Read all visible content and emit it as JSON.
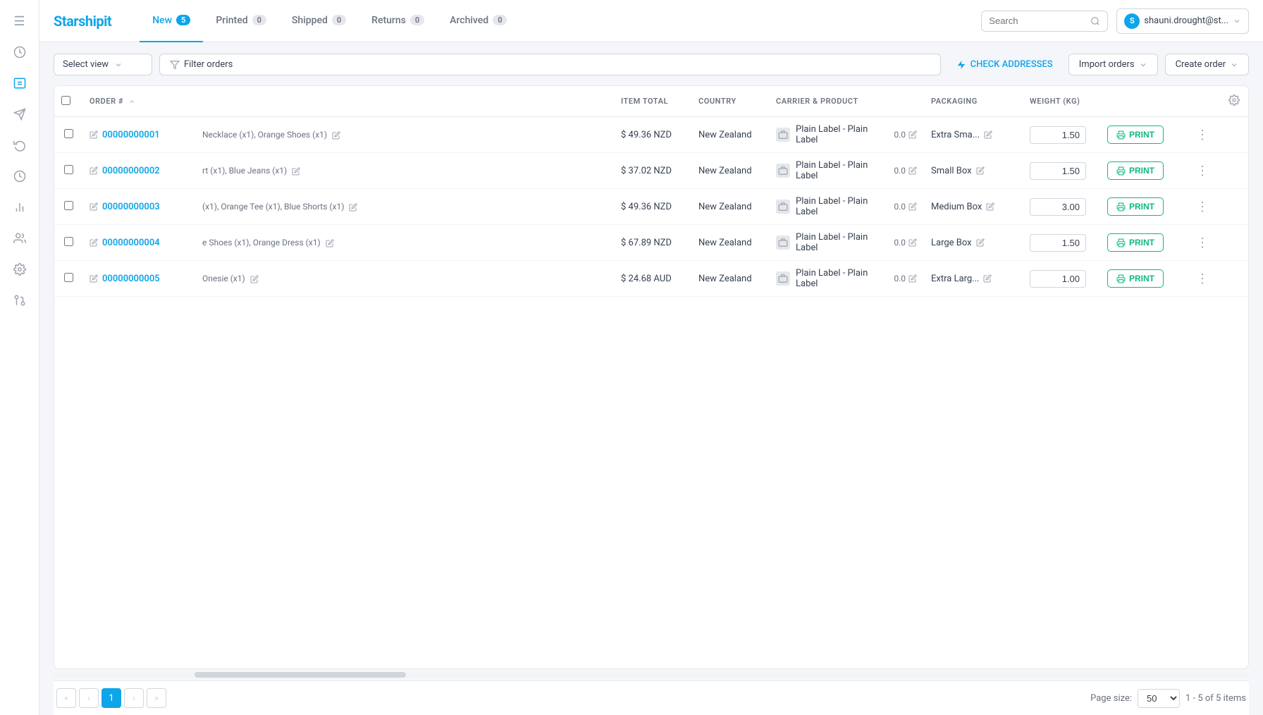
{
  "app": {
    "name": "Starshipit"
  },
  "sidebar": {
    "icons": [
      {
        "name": "menu-icon",
        "symbol": "☰"
      },
      {
        "name": "dashboard-icon",
        "symbol": "○"
      },
      {
        "name": "box-icon",
        "symbol": "⬡"
      },
      {
        "name": "send-icon",
        "symbol": "➤"
      },
      {
        "name": "history-icon",
        "symbol": "↺"
      },
      {
        "name": "clock-icon",
        "symbol": "🕐"
      },
      {
        "name": "chart-icon",
        "symbol": "▦"
      },
      {
        "name": "users-icon",
        "symbol": "👤"
      },
      {
        "name": "settings-icon",
        "symbol": "⚙"
      },
      {
        "name": "integration-icon",
        "symbol": "⚡"
      }
    ]
  },
  "nav": {
    "tabs": [
      {
        "label": "New",
        "count": "5",
        "active": true,
        "zero": false
      },
      {
        "label": "Printed",
        "count": "0",
        "active": false,
        "zero": true
      },
      {
        "label": "Shipped",
        "count": "0",
        "active": false,
        "zero": true
      },
      {
        "label": "Returns",
        "count": "0",
        "active": false,
        "zero": true
      },
      {
        "label": "Archived",
        "count": "0",
        "active": false,
        "zero": true
      }
    ]
  },
  "header": {
    "search_placeholder": "Search",
    "user_label": "shauni.drought@st...",
    "user_initials": "S"
  },
  "toolbar": {
    "select_view_label": "Select view",
    "filter_label": "Filter orders",
    "check_addresses_label": "CHECK ADDRESSES",
    "import_orders_label": "Import orders",
    "create_order_label": "Create order"
  },
  "table": {
    "columns": [
      {
        "label": "",
        "key": "check"
      },
      {
        "label": "ORDER #",
        "key": "order"
      },
      {
        "label": "ITEM TOTAL",
        "key": "total"
      },
      {
        "label": "COUNTRY",
        "key": "country"
      },
      {
        "label": "CARRIER & PRODUCT",
        "key": "carrier"
      },
      {
        "label": "PACKAGING",
        "key": "packaging"
      },
      {
        "label": "WEIGHT (KG)",
        "key": "weight"
      },
      {
        "label": "",
        "key": "print"
      },
      {
        "label": "",
        "key": "more"
      },
      {
        "label": "⚙",
        "key": "settings"
      }
    ],
    "rows": [
      {
        "id": "00000000001",
        "items": "Necklace (x1), Orange Shoes (x1)",
        "total": "$ 49.36 NZD",
        "country": "New Zealand",
        "carrier": "Plain Label - Plain Label",
        "carrier_score": "0.0",
        "packaging": "Extra Sma...",
        "weight": "1.50"
      },
      {
        "id": "00000000002",
        "items": "rt (x1), Blue Jeans (x1)",
        "total": "$ 37.02 NZD",
        "country": "New Zealand",
        "carrier": "Plain Label - Plain Label",
        "carrier_score": "0.0",
        "packaging": "Small Box",
        "weight": "1.50"
      },
      {
        "id": "00000000003",
        "items": "(x1), Orange Tee (x1), Blue Shorts (x1)",
        "total": "$ 49.36 NZD",
        "country": "New Zealand",
        "carrier": "Plain Label - Plain Label",
        "carrier_score": "0.0",
        "packaging": "Medium Box",
        "weight": "3.00"
      },
      {
        "id": "00000000004",
        "items": "e Shoes (x1), Orange Dress (x1)",
        "total": "$ 67.89 NZD",
        "country": "New Zealand",
        "carrier": "Plain Label - Plain Label",
        "carrier_score": "0.0",
        "packaging": "Large Box",
        "weight": "1.50"
      },
      {
        "id": "00000000005",
        "items": "Onesie (x1)",
        "total": "$ 24.68 AUD",
        "country": "New Zealand",
        "carrier": "Plain Label - Plain Label",
        "carrier_score": "0.0",
        "packaging": "Extra Larg...",
        "weight": "1.00"
      }
    ]
  },
  "pagination": {
    "current_page": "1",
    "page_size": "50",
    "page_size_label": "Page size:",
    "items_label": "1 - 5 of 5 items"
  },
  "print_label": "PRINT"
}
